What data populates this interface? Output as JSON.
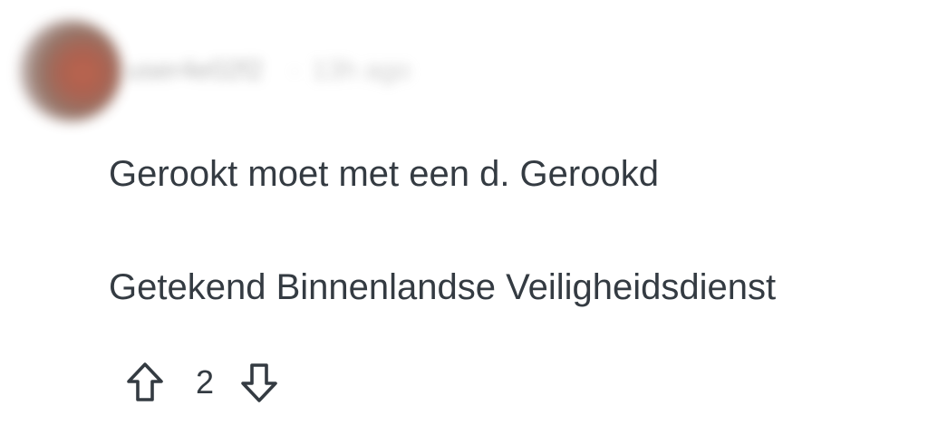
{
  "comment": {
    "author": {
      "username": "user4e02f2",
      "separator": "·",
      "timestamp": "13h ago"
    },
    "body": {
      "lines": [
        "Gerookt moet met een d. Gerookd",
        "Getekend Binnenlandse Veiligheidsdienst"
      ]
    },
    "votes": {
      "count": "2",
      "upvote_icon": "arrow-up-icon",
      "downvote_icon": "arrow-down-icon"
    }
  },
  "colors": {
    "text": "#343b42",
    "icon_stroke": "#343b42",
    "background": "#ffffff"
  }
}
